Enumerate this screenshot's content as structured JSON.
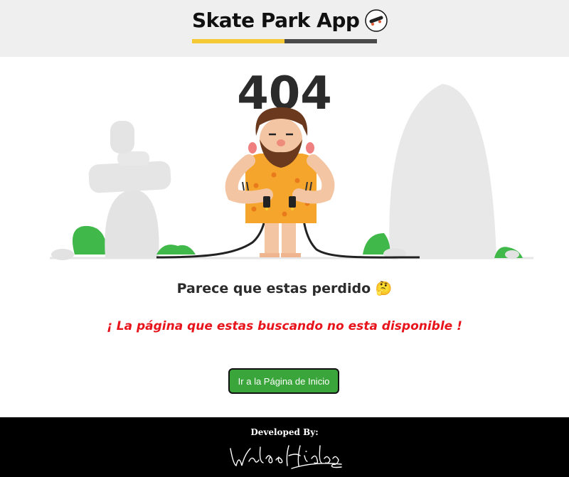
{
  "header": {
    "title": "Skate Park App",
    "icon": "skateboard-icon",
    "bar_colors": {
      "left": "#f5c933",
      "right": "#4a4a4a"
    }
  },
  "illustration": {
    "code": "404",
    "icon": "caveman-unplugged-cable-illustration"
  },
  "main": {
    "lost_message": "Parece que estas perdido 🤔",
    "error_message": "¡ La página que estas buscando no esta disponible !",
    "home_button_label": "Ir a la Página de Inicio"
  },
  "footer": {
    "developed_by": "Developed By:",
    "signature": "Waldo Hidalgo"
  },
  "colors": {
    "header_bg": "#efefef",
    "accent_green": "#3aa53a",
    "error_red": "#e8141b",
    "footer_bg": "#000000"
  }
}
